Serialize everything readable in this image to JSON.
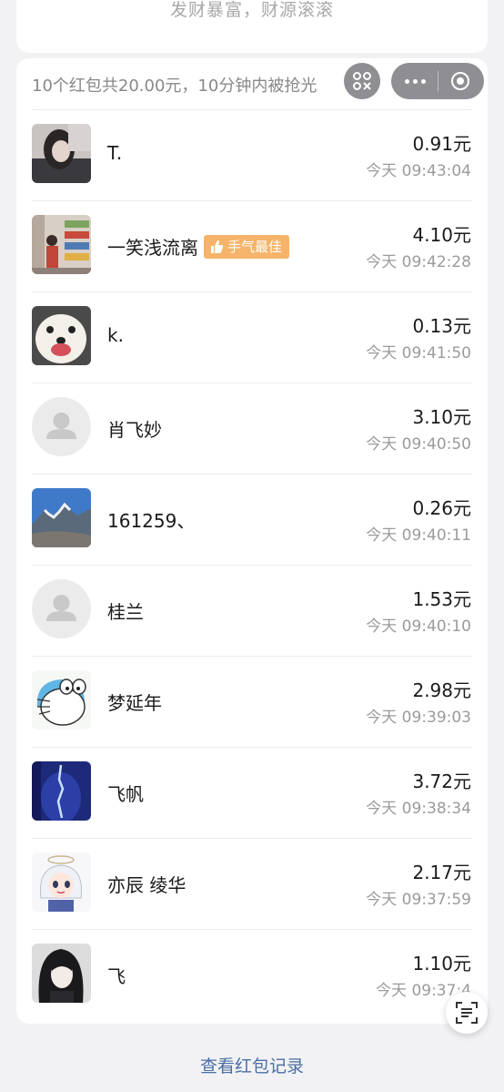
{
  "header": {
    "blessing": "发财暴富，财源滚滚"
  },
  "summary": {
    "text": "10个红包共20.00元，10分钟内被抢光"
  },
  "mini_program": {
    "grid_icon": "mini-program-grid-icon",
    "more_icon": "more-dots-icon",
    "close_icon": "close-target-icon"
  },
  "badge": {
    "best_luck": "手气最佳"
  },
  "entries": [
    {
      "name": "T.",
      "amount": "0.91元",
      "time": "今天 09:43:04",
      "avatar": "photo-avatar-dark-hair"
    },
    {
      "name": "一笑浅流离",
      "amount": "4.10元",
      "time": "今天 09:42:28",
      "avatar": "photo-avatar-shop",
      "best": true
    },
    {
      "name": "k.",
      "amount": "0.13元",
      "time": "今天 09:41:50",
      "avatar": "photo-avatar-dog"
    },
    {
      "name": "肖飞妙",
      "amount": "3.10元",
      "time": "今天 09:40:50",
      "avatar": "default-avatar"
    },
    {
      "name": "161259、",
      "amount": "0.26元",
      "time": "今天 09:40:11",
      "avatar": "photo-avatar-mountains"
    },
    {
      "name": "桂兰",
      "amount": "1.53元",
      "time": "今天 09:40:10",
      "avatar": "default-avatar"
    },
    {
      "name": "梦延年",
      "amount": "2.98元",
      "time": "今天 09:39:03",
      "avatar": "photo-avatar-cartoon-cat"
    },
    {
      "name": "飞帆",
      "amount": "3.72元",
      "time": "今天 09:38:34",
      "avatar": "photo-avatar-blue-figure"
    },
    {
      "name": "亦辰 绫华",
      "amount": "2.17元",
      "time": "今天 09:37:59",
      "avatar": "photo-avatar-anime-girl"
    },
    {
      "name": "飞",
      "amount": "1.10元",
      "time": "今天 09:37:4",
      "avatar": "photo-avatar-anime-boy"
    }
  ],
  "footer": {
    "view_records": "查看红包记录"
  },
  "colors": {
    "background": "#f2f2f4",
    "link": "#4a6fa5",
    "badge": "#f5b46a",
    "capsule": "#8e8e93"
  }
}
